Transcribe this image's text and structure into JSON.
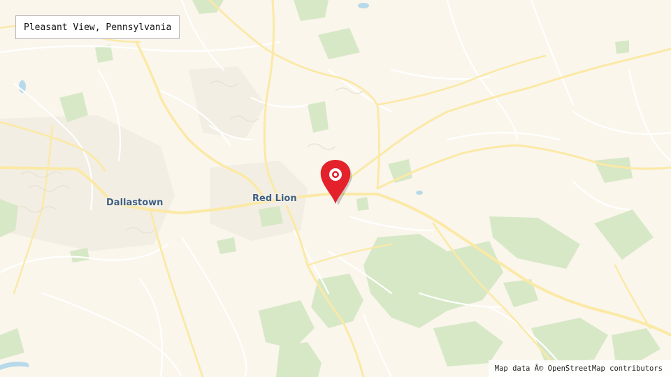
{
  "map": {
    "title": "Pleasant View, Pennsylvania",
    "attribution": "Map data Â© OpenStreetMap contributors",
    "places": [
      {
        "id": "dallastown",
        "name": "Dallastown"
      },
      {
        "id": "red-lion",
        "name": "Red Lion"
      }
    ],
    "marker": {
      "icon": "location-pin-icon",
      "color": "#e3222b"
    },
    "colors": {
      "background": "#faf6ec",
      "road": "#fbe9a6",
      "minor_road": "#ffffff",
      "woods": "#d7e8c6",
      "water": "#b7d9ea",
      "label": "#3e5f84"
    }
  }
}
